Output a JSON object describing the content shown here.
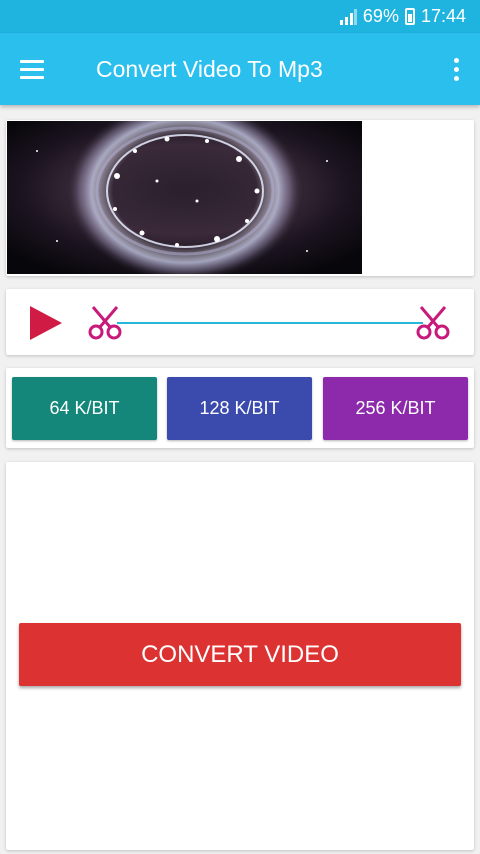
{
  "status_bar": {
    "battery_percent": "69%",
    "time": "17:44"
  },
  "app_bar": {
    "title": "Convert Video To Mp3",
    "menu_icon": "hamburger-icon",
    "more_icon": "more-vert-icon"
  },
  "trim": {
    "play_icon": "play-icon",
    "start_icon": "scissors-icon",
    "end_icon": "scissors-icon"
  },
  "bitrates": [
    {
      "label": "64 K/BIT",
      "color": "#14877a"
    },
    {
      "label": "128 K/BIT",
      "color": "#3b4aad"
    },
    {
      "label": "256 K/BIT",
      "color": "#8c2aab"
    }
  ],
  "convert": {
    "label": "CONVERT VIDEO",
    "color": "#dc3232"
  },
  "colors": {
    "status_bar": "#1fb4e0",
    "app_bar": "#2bbfee",
    "trim_line": "#27b7d9",
    "play": "#d01c45",
    "scissors": "#c81a7a"
  }
}
